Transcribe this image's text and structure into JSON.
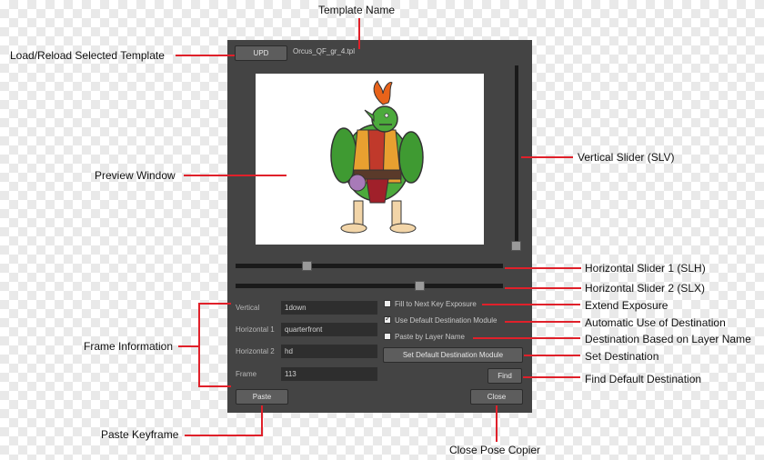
{
  "window": {
    "upd_label": "UPD",
    "template_file": "Orcus_QF_gr_4.tpl",
    "fields": [
      {
        "label": "Vertical",
        "value": "1down"
      },
      {
        "label": "Horizontal 1",
        "value": "quarterfront"
      },
      {
        "label": "Horizontal 2",
        "value": "hd"
      },
      {
        "label": "Frame",
        "value": "113"
      }
    ],
    "checkboxes": [
      {
        "label": "Fill to Next Key Exposure",
        "checked": false
      },
      {
        "label": "Use Default Destination Module",
        "checked": true
      },
      {
        "label": "Paste by Layer Name",
        "checked": false
      }
    ],
    "set_default_label": "Set Default Destination Module",
    "find_label": "Find",
    "paste_label": "Paste",
    "close_label": "Close",
    "sliders": {
      "vertical": 1.0,
      "horizontal1": 0.27,
      "horizontal2": 0.68
    }
  },
  "annotations": {
    "template_name": "Template Name",
    "load_reload": "Load/Reload Selected Template",
    "preview_window": "Preview Window",
    "vertical_slider": "Vertical Slider (SLV)",
    "horizontal_slider_1": "Horizontal Slider 1 (SLH)",
    "horizontal_slider_2": "Horizontal Slider 2 (SLX)",
    "extend_exposure": "Extend Exposure",
    "automatic_use": "Automatic Use of Destination",
    "destination_layer": "Destination Based on Layer Name",
    "set_destination": "Set Destination",
    "find_default": "Find Default Destination",
    "frame_information": "Frame Information",
    "paste_keyframe": "Paste Keyframe",
    "close_pose_copier": "Close Pose Copier"
  },
  "colors": {
    "panel": "#444444",
    "annotation_line": "#e0202a",
    "field_bg": "#2e2e2e"
  }
}
